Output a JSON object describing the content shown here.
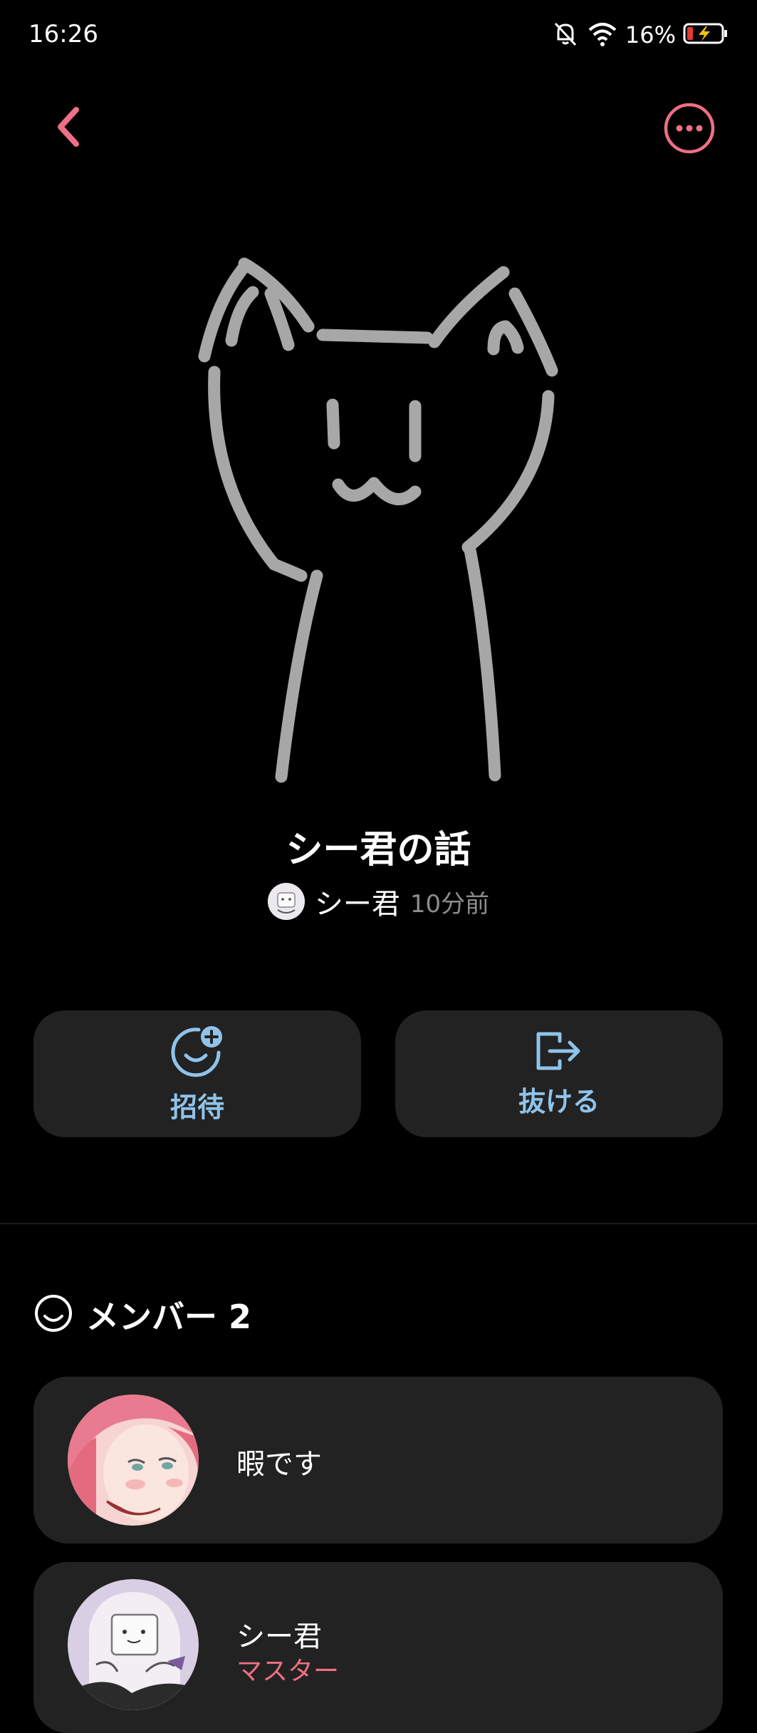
{
  "status_bar": {
    "time": "16:26",
    "battery_percent": "16%",
    "icons": [
      "bell-off-icon",
      "wifi-icon",
      "battery-charging-icon"
    ]
  },
  "nav": {
    "back_icon": "chevron-left-icon",
    "more_icon": "more-horizontal-circle-icon"
  },
  "group": {
    "title": "シー君の話",
    "creator": "シー君",
    "updated": "10分前"
  },
  "actions": {
    "invite_label": "招待",
    "invite_icon": "smiley-plus-icon",
    "leave_label": "抜ける",
    "leave_icon": "exit-icon"
  },
  "members": {
    "header": "メンバー 2",
    "header_icon": "smiley-icon",
    "items": [
      {
        "name": "暇です",
        "role": ""
      },
      {
        "name": "シー君",
        "role": "マスター"
      }
    ]
  },
  "colors": {
    "accent_pink": "#ee6f86",
    "accent_blue": "#8fc3ea",
    "card_bg": "#222222",
    "background": "#000000"
  }
}
